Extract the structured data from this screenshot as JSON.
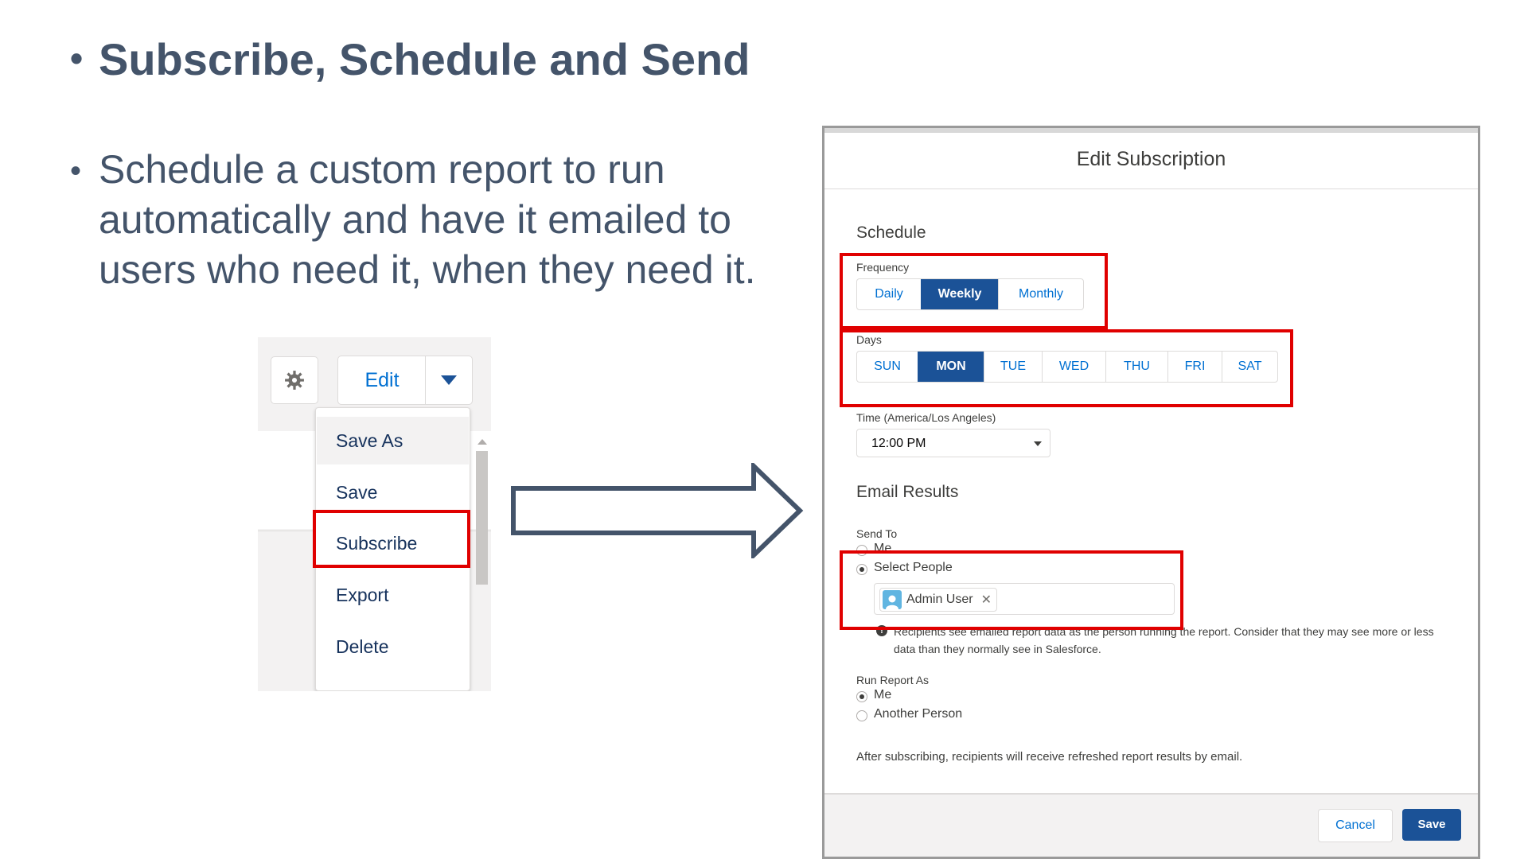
{
  "slide": {
    "bullet1": "Subscribe, Schedule and Send",
    "bullet2_lines": [
      "Schedule a custom report to run",
      "automatically and have it emailed to",
      "users who need it, when they need it."
    ],
    "bullet_glyph": "•"
  },
  "menu": {
    "edit_label": "Edit",
    "items": [
      "Save As",
      "Save",
      "Subscribe",
      "Export",
      "Delete"
    ],
    "icons": {
      "gear": "gear-icon",
      "dropdown": "chevron-down-icon"
    }
  },
  "dialog": {
    "title": "Edit Subscription",
    "schedule_title": "Schedule",
    "frequency_label": "Frequency",
    "frequency_options": [
      "Daily",
      "Weekly",
      "Monthly"
    ],
    "frequency_selected": "Weekly",
    "days_label": "Days",
    "days": [
      "SUN",
      "MON",
      "TUE",
      "WED",
      "THU",
      "FRI",
      "SAT"
    ],
    "days_selected": [
      "MON"
    ],
    "time_label": "Time (America/Los Angeles)",
    "time_value": "12:00 PM",
    "email_title": "Email Results",
    "send_to_label": "Send To",
    "send_to_options": [
      "Me",
      "Select People"
    ],
    "send_to_selected": "Select People",
    "recipient": "Admin User",
    "info_text": "Recipients see emailed report data as the person running the report. Consider that they may see more or less data than they normally see in Salesforce.",
    "run_as_label": "Run Report As",
    "run_as_options": [
      "Me",
      "Another Person"
    ],
    "run_as_selected": "Me",
    "after_text": "After subscribing, recipients will receive refreshed report results by email.",
    "cancel_label": "Cancel",
    "save_label": "Save"
  },
  "colors": {
    "slide_text": "#44546a",
    "highlight": "#e00000",
    "brand_blue": "#1b5297",
    "link_blue": "#0070d2"
  }
}
